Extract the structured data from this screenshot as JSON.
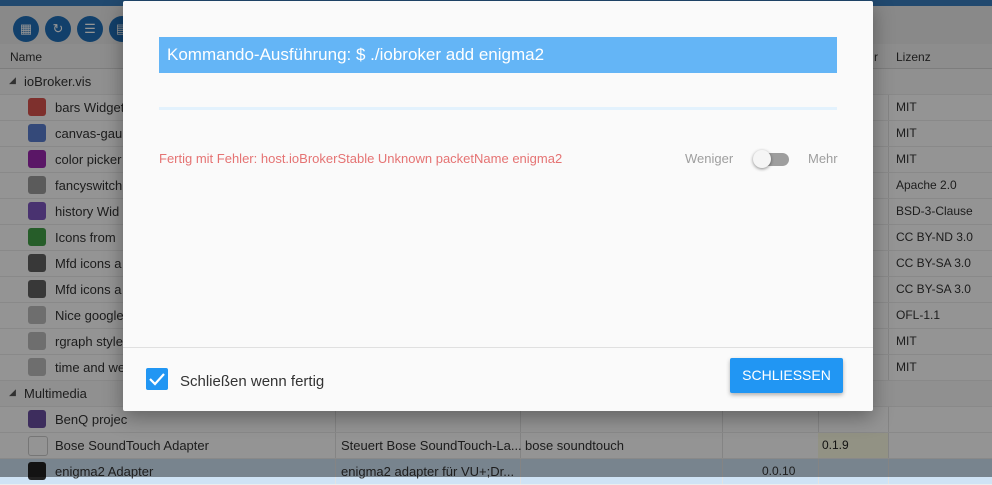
{
  "header": {
    "col_name": "Name",
    "col_installed_fragment": "r",
    "col_license": "Lizenz"
  },
  "groups": [
    {
      "label": "ioBroker.vis",
      "rows": [
        {
          "name": "bars Widget",
          "icon_color": "#d9534f",
          "license": "MIT"
        },
        {
          "name": "canvas-gau",
          "icon_color": "#5b7fd0",
          "license": "MIT"
        },
        {
          "name": "color picker",
          "icon_color": "#9c27b0",
          "license": "MIT"
        },
        {
          "name": "fancyswitch",
          "icon_color": "#9e9e9e",
          "license": "Apache 2.0"
        },
        {
          "name": "history Wid",
          "icon_color": "#7e57c2",
          "license": "BSD-3-Clause"
        },
        {
          "name": "Icons from",
          "icon_color": "#43a047",
          "license": "CC BY-ND 3.0"
        },
        {
          "name": "Mfd icons a",
          "icon_color": "#616161",
          "license": "CC BY-SA 3.0"
        },
        {
          "name": "Mfd icons a",
          "icon_color": "#616161",
          "license": "CC BY-SA 3.0"
        },
        {
          "name": "Nice google",
          "icon_color": "#bdbdbd",
          "license": "OFL-1.1"
        },
        {
          "name": "rgraph style",
          "icon_color": "#bdbdbd",
          "license": "MIT"
        },
        {
          "name": "time and we",
          "icon_color": "#bdbdbd",
          "license": "MIT"
        }
      ]
    },
    {
      "label": "Multimedia",
      "rows": [
        {
          "name": "BenQ projec",
          "icon_color": "#6a4fa0",
          "license": ""
        },
        {
          "name": "Bose SoundTouch Adapter",
          "icon_color": "#ffffff",
          "desc": "Steuert Bose SoundTouch-La...",
          "keywords": "bose soundtouch",
          "version": "0.1.9",
          "license": ""
        },
        {
          "name": "enigma2 Adapter",
          "icon_color": "#222222",
          "desc": "enigma2 adapter für VU+;Dr...",
          "installed": "0.0.10",
          "license": "",
          "selected": true
        }
      ]
    }
  ],
  "dialog": {
    "title": "Kommando-Ausführung: $ ./iobroker add enigma2",
    "error_message": "Fertig mit Fehler: host.ioBrokerStable Unknown packetName enigma2",
    "less_label": "Weniger",
    "more_label": "Mehr",
    "close_when_done_label": "Schließen wenn fertig",
    "close_when_done_checked": true,
    "close_button_label": "SCHLIESSEN",
    "accent_color": "#2196f3",
    "title_bg": "#64b5f6",
    "error_color": "#e57373"
  }
}
